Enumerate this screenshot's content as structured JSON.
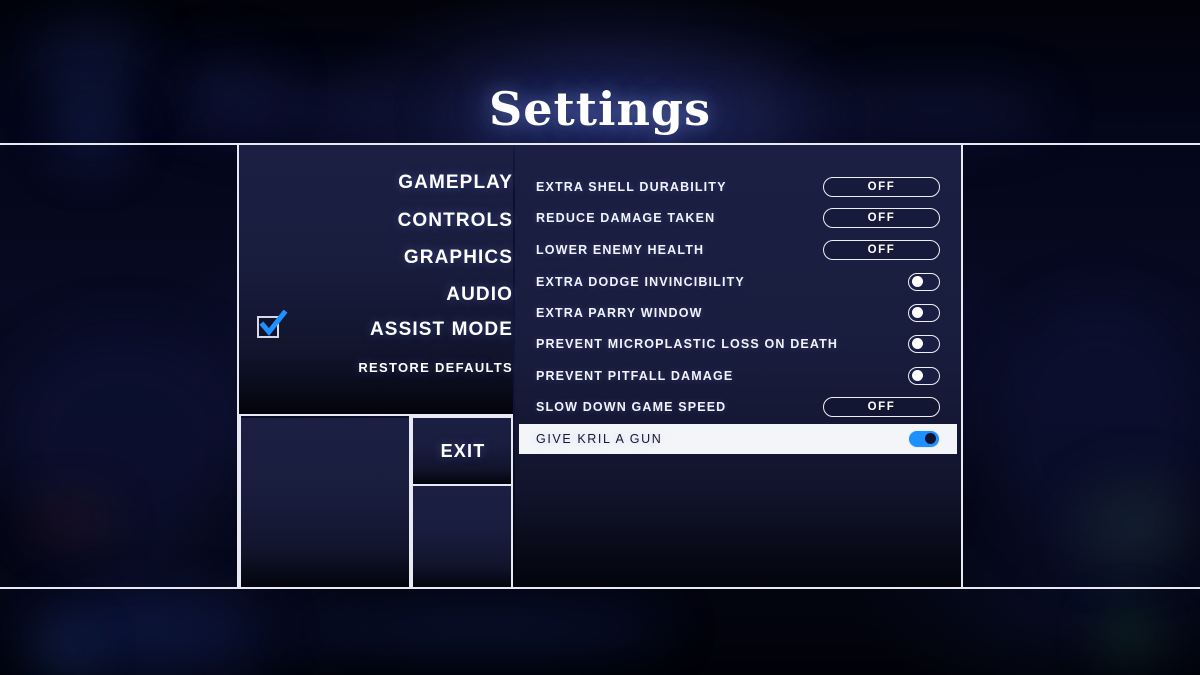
{
  "title": "Settings",
  "nav": {
    "items": [
      {
        "label": "GAMEPLAY",
        "selected": false
      },
      {
        "label": "CONTROLS",
        "selected": false
      },
      {
        "label": "GRAPHICS",
        "selected": false
      },
      {
        "label": "AUDIO",
        "selected": false
      },
      {
        "label": "ASSIST MODE",
        "selected": true
      },
      {
        "label": "RESTORE DEFAULTS",
        "selected": false
      }
    ],
    "assist_mode_checkbox": {
      "icon": "checkbox-checked-icon",
      "checked": true,
      "check_color": "#1E90FF"
    }
  },
  "settings": {
    "rows": [
      {
        "label": "EXTRA SHELL DURABILITY",
        "control": "pill",
        "value": "OFF",
        "on": false,
        "highlighted": false
      },
      {
        "label": "REDUCE DAMAGE TAKEN",
        "control": "pill",
        "value": "OFF",
        "on": false,
        "highlighted": false
      },
      {
        "label": "LOWER ENEMY HEALTH",
        "control": "pill",
        "value": "OFF",
        "on": false,
        "highlighted": false
      },
      {
        "label": "EXTRA DODGE INVINCIBILITY",
        "control": "toggle",
        "value": "",
        "on": false,
        "highlighted": false
      },
      {
        "label": "EXTRA PARRY WINDOW",
        "control": "toggle",
        "value": "",
        "on": false,
        "highlighted": false
      },
      {
        "label": "PREVENT MICROPLASTIC LOSS ON DEATH",
        "control": "toggle",
        "value": "",
        "on": false,
        "highlighted": false
      },
      {
        "label": "PREVENT PITFALL DAMAGE",
        "control": "toggle",
        "value": "",
        "on": false,
        "highlighted": false
      },
      {
        "label": "SLOW DOWN GAME SPEED",
        "control": "pill",
        "value": "OFF",
        "on": false,
        "highlighted": false
      },
      {
        "label": "GIVE KRIL A GUN",
        "control": "toggle",
        "value": "",
        "on": true,
        "highlighted": true
      }
    ]
  },
  "footer": {
    "exit_label": "EXIT"
  },
  "colors": {
    "accent_blue": "#1E90FF",
    "panel_navy": "#1B1F43",
    "frame_white": "#E8E9F2",
    "highlight_row_bg": "#F4F5F9",
    "highlight_row_text": "#16182C"
  }
}
